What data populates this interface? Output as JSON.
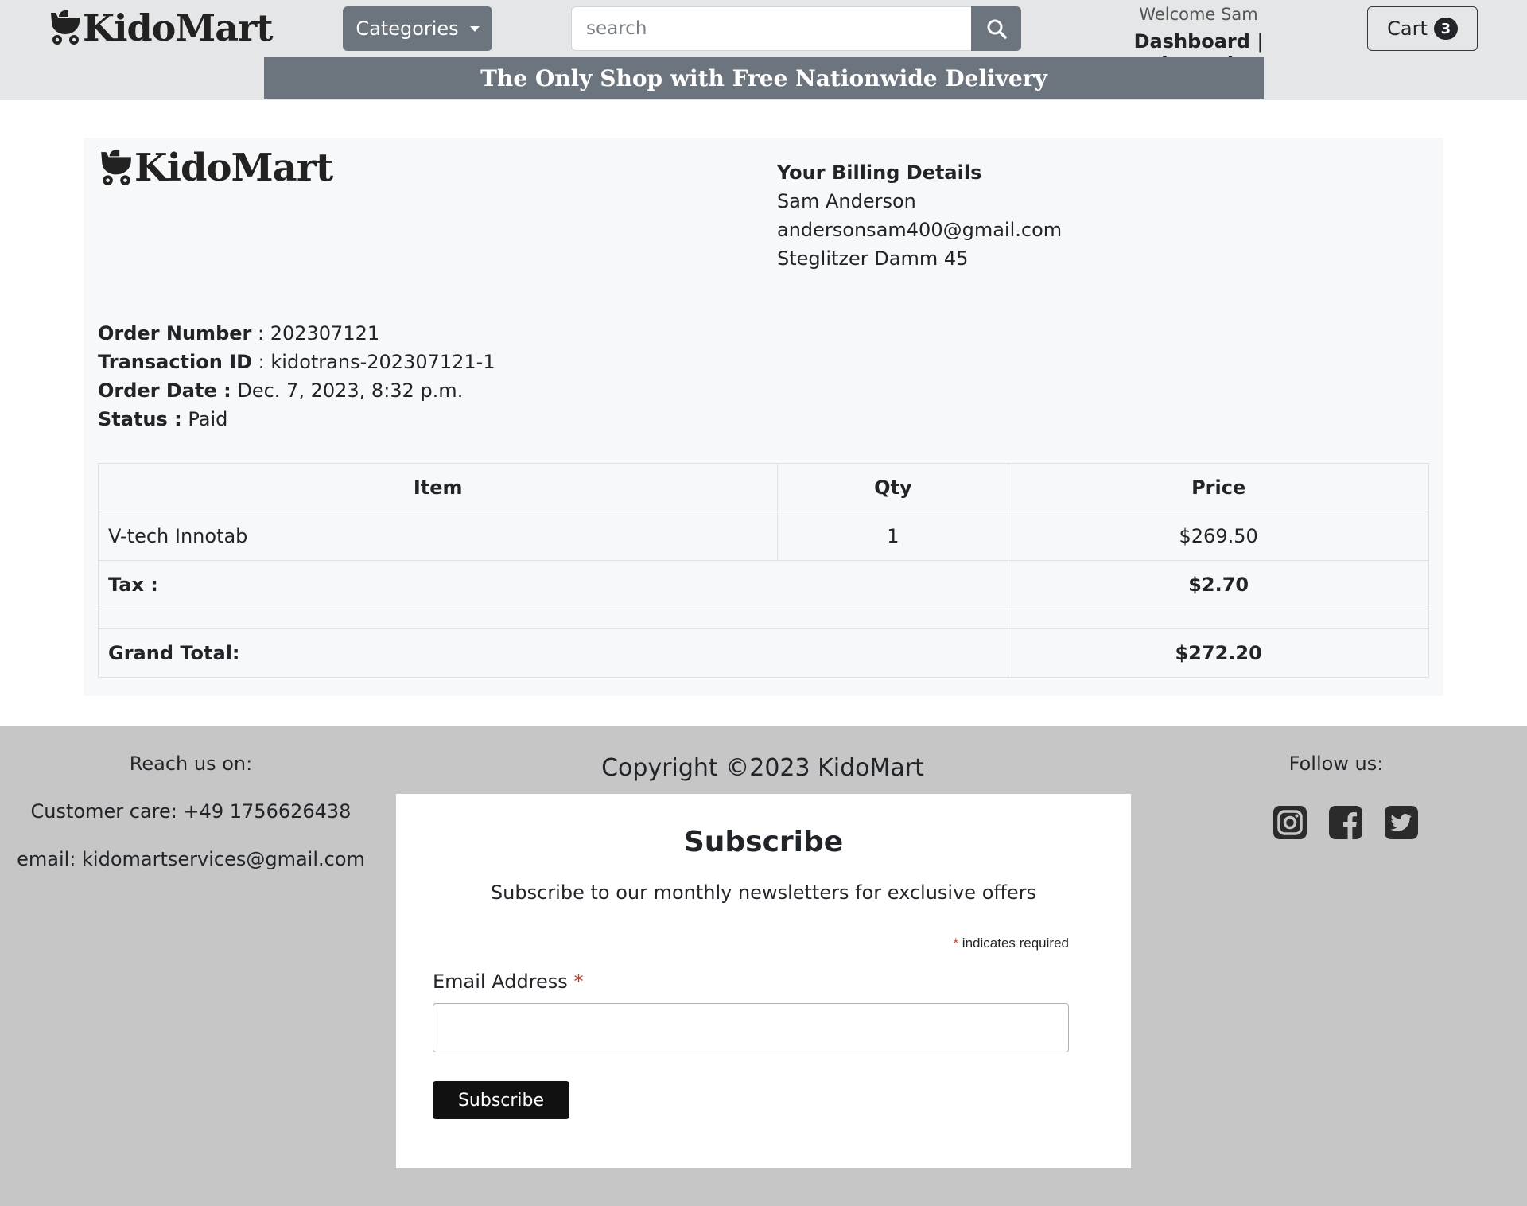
{
  "header": {
    "logo_text": "KidoMart",
    "categories_label": "Categories",
    "search_placeholder": "search",
    "welcome": "Welcome Sam",
    "dashboard_label": "Dashboard",
    "separator": "|",
    "logout_label": "Logout",
    "cart_label": "Cart",
    "cart_count": "3",
    "promo": "The Only Shop with Free Nationwide Delivery"
  },
  "order": {
    "logo_text": "KidoMart",
    "billing": {
      "title": "Your Billing Details",
      "name": "Sam Anderson",
      "email": "andersonsam400@gmail.com",
      "address": "Steglitzer Damm 45"
    },
    "meta": {
      "order_number_label": "Order Number",
      "order_number": "202307121",
      "transaction_label": "Transaction ID",
      "transaction_id": "kidotrans-202307121-1",
      "date_label": "Order Date :",
      "date": "Dec. 7, 2023, 8:32 p.m.",
      "status_label": "Status :",
      "status": "Paid"
    },
    "table": {
      "columns": [
        "Item",
        "Qty",
        "Price"
      ],
      "rows": [
        {
          "item": "V-tech Innotab",
          "qty": "1",
          "price": "$269.50"
        }
      ],
      "tax_label": "Tax :",
      "tax": "$2.70",
      "total_label": "Grand Total:",
      "total": "$272.20"
    }
  },
  "footer": {
    "reach_title": "Reach us on:",
    "phone": "Customer care: +49 1756626438",
    "email_label": "email:",
    "email": "kidomartservices@gmail.com",
    "copyright": "Copyright ©2023 KidoMart",
    "follow_title": "Follow us:",
    "social_icons": [
      "instagram-icon",
      "facebook-icon",
      "twitter-icon"
    ],
    "subscribe": {
      "title": "Subscribe",
      "text": "Subscribe to our monthly newsletters for exclusive offers",
      "required_note": "indicates required",
      "required_mark": "*",
      "email_label": "Email Address",
      "button": "Subscribe"
    }
  },
  "colors": {
    "header_bg": "#e5e6e7",
    "secondary": "#6c757d",
    "card_bg": "#f7f8f9",
    "footer_bg": "#c6c6c6",
    "dark": "#212529"
  }
}
